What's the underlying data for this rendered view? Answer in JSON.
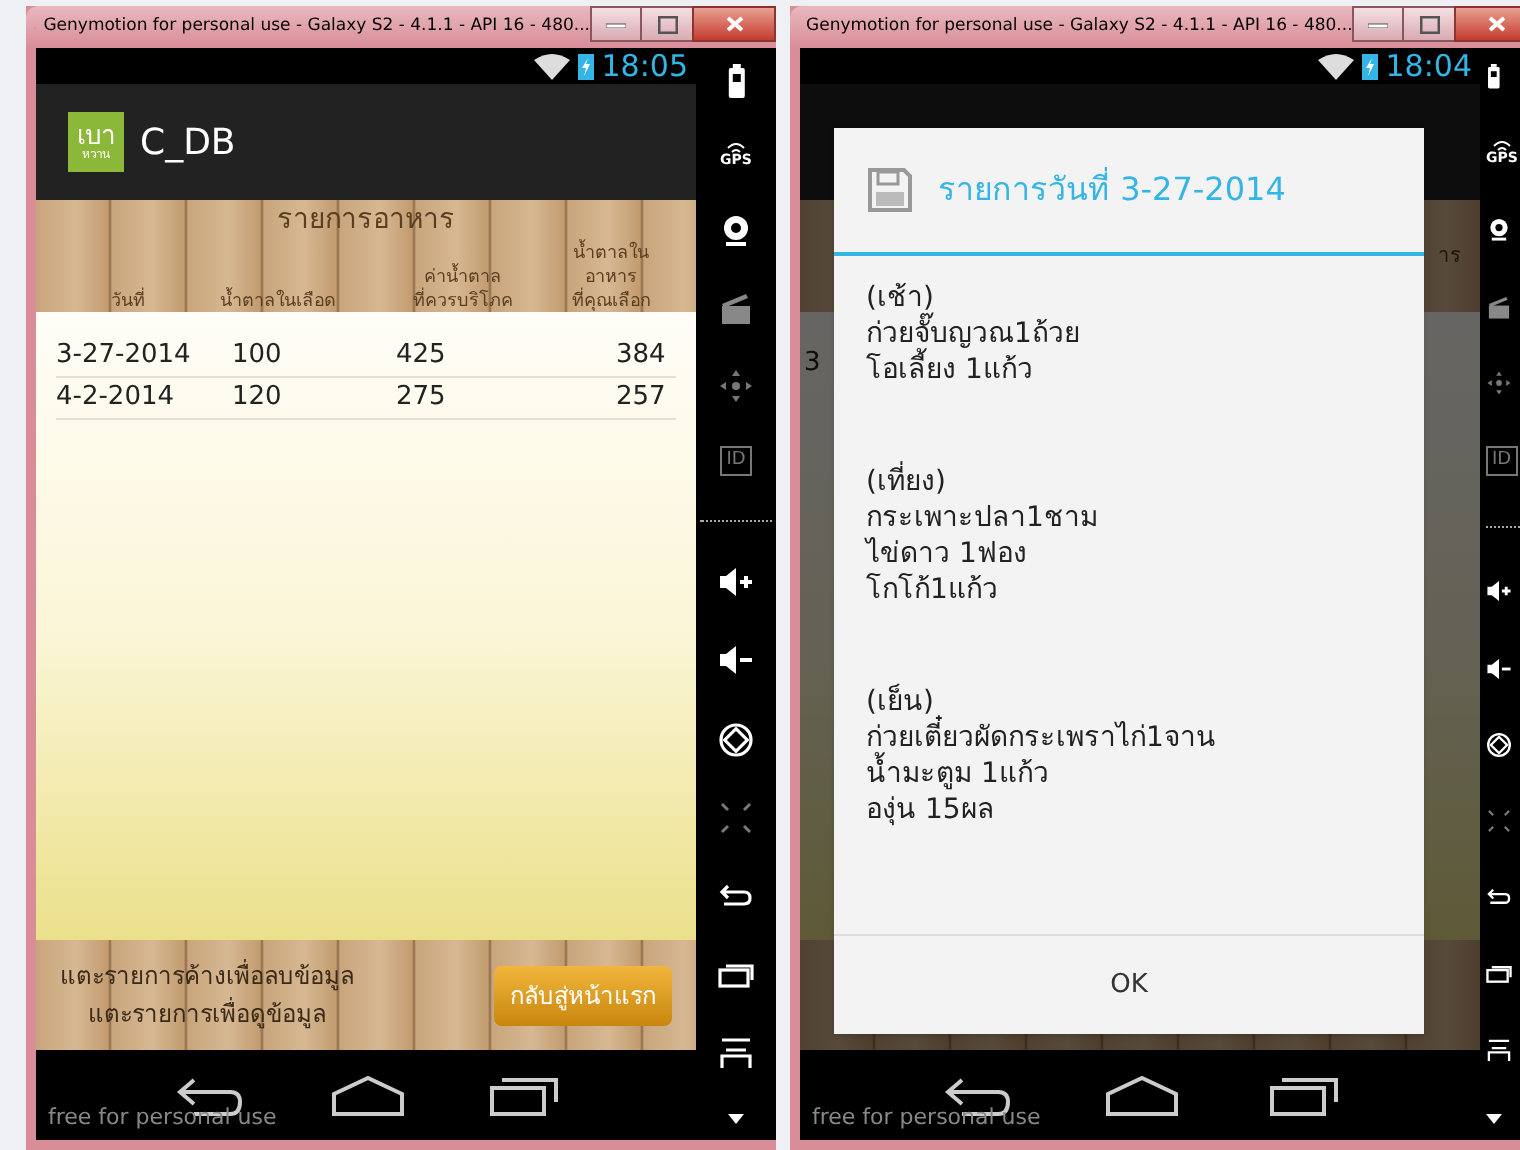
{
  "windows": [
    {
      "title": "Genymotion for personal use - Galaxy S2 - 4.1.1 - API 16 - 480...",
      "status_time": "18:05",
      "watermark": "free for personal use",
      "sidebar": [
        {
          "kind": "battery"
        },
        {
          "kind": "gps",
          "label": "GPS"
        },
        {
          "kind": "webcam"
        },
        {
          "kind": "clapper"
        },
        {
          "kind": "dpad"
        },
        {
          "kind": "id",
          "label": "ID"
        },
        {
          "kind": "divider"
        },
        {
          "kind": "vol_up"
        },
        {
          "kind": "vol_down"
        },
        {
          "kind": "rotate"
        },
        {
          "kind": "scale"
        },
        {
          "kind": "back"
        },
        {
          "kind": "recents"
        },
        {
          "kind": "menu"
        },
        {
          "kind": "more"
        }
      ]
    },
    {
      "title": "Genymotion for personal use - Galaxy S2 - 4.1.1 - API 16 - 480...",
      "status_time": "18:04",
      "watermark": "free for personal use",
      "sidebar": [
        {
          "kind": "battery"
        },
        {
          "kind": "gps",
          "label": "GPS"
        },
        {
          "kind": "webcam"
        },
        {
          "kind": "clapper"
        },
        {
          "kind": "dpad"
        },
        {
          "kind": "id",
          "label": "ID"
        },
        {
          "kind": "divider"
        },
        {
          "kind": "vol_up"
        },
        {
          "kind": "vol_down"
        },
        {
          "kind": "rotate"
        },
        {
          "kind": "scale"
        },
        {
          "kind": "back"
        },
        {
          "kind": "recents"
        },
        {
          "kind": "menu"
        },
        {
          "kind": "more"
        }
      ]
    }
  ],
  "app": {
    "title": "C_DB",
    "logo_text": [
      "เบา",
      "หวาน"
    ],
    "section_title": "รายการอาหาร",
    "columns": [
      "วันที่",
      "น้ำตาลในเลือด",
      "ค่าน้ำตาล\nที่ควรบริโภค",
      "น้ำตาลในอาหาร\nที่คุณเลือก"
    ],
    "rows": [
      [
        "3-27-2014",
        "100",
        "425",
        "384"
      ],
      [
        "4-2-2014",
        "120",
        "275",
        "257"
      ]
    ],
    "hints": [
      "แตะรายการค้างเพื่อลบข้อมูล",
      "แตะรายการเพื่อดูข้อมูล"
    ],
    "home_button": "กลับสู่หน้าแรก"
  },
  "background_fragments": {
    "header": "าร",
    "row": "3"
  },
  "dialog": {
    "title": "รายการวันที่ 3-27-2014",
    "meals": [
      {
        "label": "(เช้า)",
        "items": [
          "ก่วยจั๊บญวณ1ถ้วย",
          "โอเลี้ยง 1แก้ว"
        ]
      },
      {
        "label": "(เที่ยง)",
        "items": [
          "กระเพาะปลา1ชาม",
          "ไข่ดาว 1ฟอง",
          "โกโก้1แก้ว"
        ]
      },
      {
        "label": "(เย็น)",
        "items": [
          "ก่วยเตี๋ยวผัดกระเพราไก่1จาน",
          "น้ำมะตูม 1แก้ว",
          "องุ่น 15ผล"
        ]
      }
    ],
    "ok_button": "OK"
  }
}
